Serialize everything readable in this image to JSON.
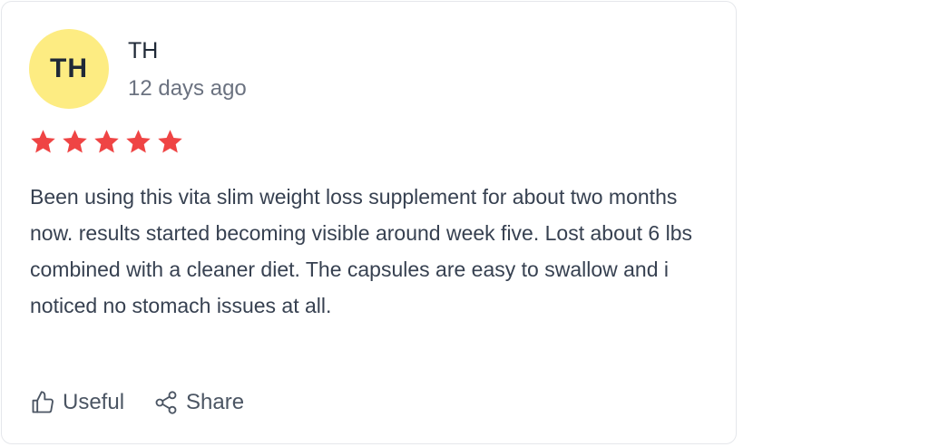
{
  "review": {
    "avatar_initials": "TH",
    "avatar_color": "#fdec82",
    "author": "TH",
    "time": "12 days ago",
    "rating": 5,
    "rating_max": 5,
    "star_color": "#ef4444",
    "text": "Been using this vita slim weight loss supplement for about two months now. results started becoming visible around week five. Lost about 6 lbs combined with a cleaner diet. The capsules are easy to swallow and i noticed no stomach issues at all."
  },
  "actions": {
    "useful_label": "Useful",
    "useful_icon": "thumbs-up-icon",
    "share_label": "Share",
    "share_icon": "share-icon"
  }
}
